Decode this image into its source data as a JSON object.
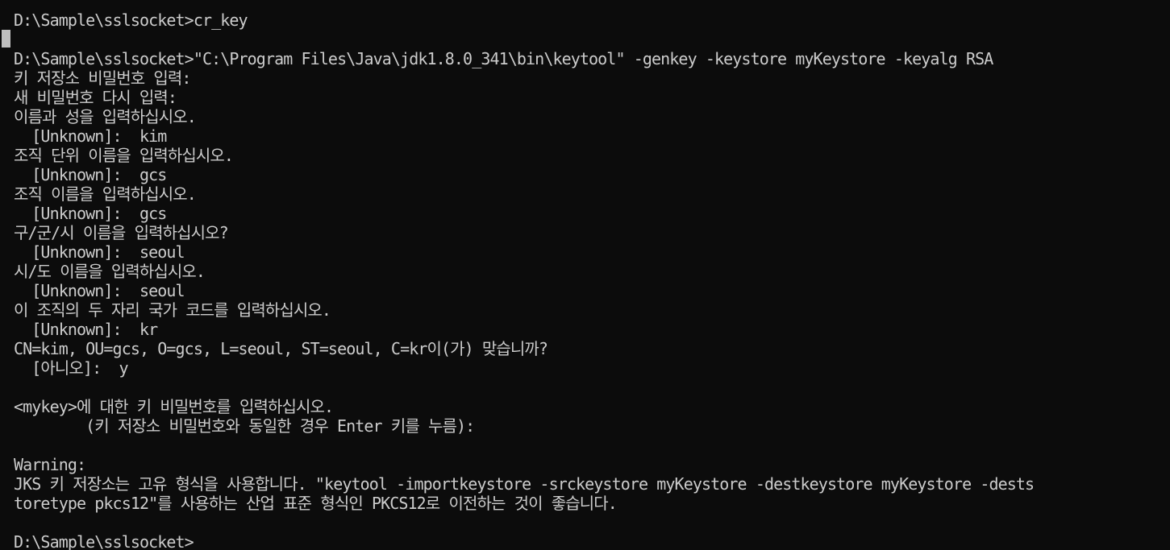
{
  "terminal": {
    "lines": [
      "D:\\Sample\\sslsocket>cr_key",
      "",
      "D:\\Sample\\sslsocket>\"C:\\Program Files\\Java\\jdk1.8.0_341\\bin\\keytool\" -genkey -keystore myKeystore -keyalg RSA",
      "키 저장소 비밀번호 입력:",
      "새 비밀번호 다시 입력:",
      "이름과 성을 입력하십시오.",
      "  [Unknown]:  kim",
      "조직 단위 이름을 입력하십시오.",
      "  [Unknown]:  gcs",
      "조직 이름을 입력하십시오.",
      "  [Unknown]:  gcs",
      "구/군/시 이름을 입력하십시오?",
      "  [Unknown]:  seoul",
      "시/도 이름을 입력하십시오.",
      "  [Unknown]:  seoul",
      "이 조직의 두 자리 국가 코드를 입력하십시오.",
      "  [Unknown]:  kr",
      "CN=kim, OU=gcs, O=gcs, L=seoul, ST=seoul, C=kr이(가) 맞습니까?",
      "  [아니오]:  y",
      "",
      "<mykey>에 대한 키 비밀번호를 입력하십시오.",
      "        (키 저장소 비밀번호와 동일한 경우 Enter 키를 누름):",
      "",
      "Warning:",
      "JKS 키 저장소는 고유 형식을 사용합니다. \"keytool -importkeystore -srckeystore myKeystore -destkeystore myKeystore -dests",
      "toretype pkcs12\"를 사용하는 산업 표준 형식인 PKCS12로 이전하는 것이 좋습니다.",
      "",
      "D:\\Sample\\sslsocket>"
    ]
  },
  "colors": {
    "background": "#0c0c0c",
    "text": "#cccccc",
    "cursor": "#bfbfbf"
  }
}
